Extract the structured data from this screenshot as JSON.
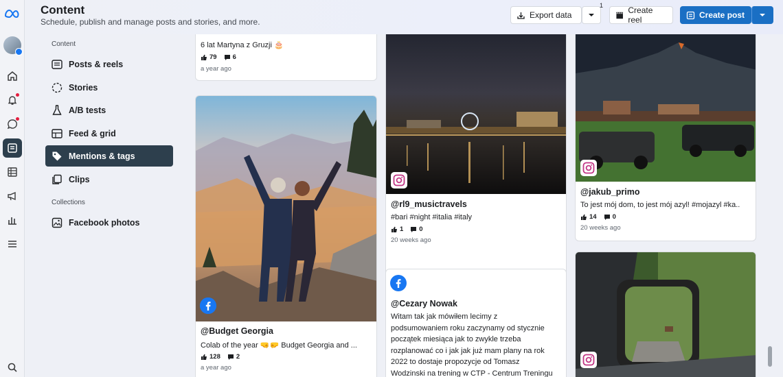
{
  "header": {
    "title": "Content",
    "subtitle": "Schedule, publish and manage posts and stories, and more.",
    "export_label": "Export data",
    "notification_count": "1",
    "create_reel_label": "Create reel",
    "create_post_label": "Create post"
  },
  "sidebar": {
    "section_content": "Content",
    "section_collections": "Collections",
    "items": [
      {
        "label": "Posts & reels",
        "icon": "posts-icon"
      },
      {
        "label": "Stories",
        "icon": "stories-icon"
      },
      {
        "label": "A/B tests",
        "icon": "flask-icon"
      },
      {
        "label": "Feed & grid",
        "icon": "feed-grid-icon"
      },
      {
        "label": "Mentions & tags",
        "icon": "tag-icon",
        "active": true
      },
      {
        "label": "Clips",
        "icon": "clips-icon"
      }
    ],
    "collections": [
      {
        "label": "Facebook photos",
        "icon": "photo-icon"
      }
    ]
  },
  "posts": [
    {
      "caption": "6 lat Martyna z Gruzji 🎂",
      "likes": "79",
      "comments": "6",
      "time": "a year ago"
    },
    {
      "platform": "facebook",
      "username": "@Budget Georgia",
      "caption": "Colab of the year 🤜🤛 Budget Georgia and ...",
      "likes": "128",
      "comments": "2",
      "time": "a year ago"
    },
    {
      "platform": "instagram",
      "username": "@rl9_musictravels",
      "caption": "#bari #night #italia #italy",
      "likes": "1",
      "comments": "0",
      "time": "20 weeks ago"
    },
    {
      "platform": "facebook",
      "username": "@Cezary Nowak",
      "text": "Witam tak jak mówiłem lecimy z\npodsumowaniem roku zaczynamy od stycznie\npoczątek miesiąca jak to zwykle trzeba\nrozplanować co i jak jak już mam plany na rok\n2022 to dostaje propozycje od Tomasz\nWodzinski na trening w CTP - Centrum Treningu"
    },
    {
      "platform": "instagram",
      "username": "@jakub_primo",
      "caption": "To jest mój dom, to jest mój azyl! #mojazyl #ka..",
      "likes": "14",
      "comments": "0",
      "time": "20 weeks ago"
    },
    {
      "platform": "instagram"
    }
  ],
  "colors": {
    "accent": "#1a6fc4",
    "active_nav": "#2d3f4d",
    "facebook": "#1877f2"
  }
}
